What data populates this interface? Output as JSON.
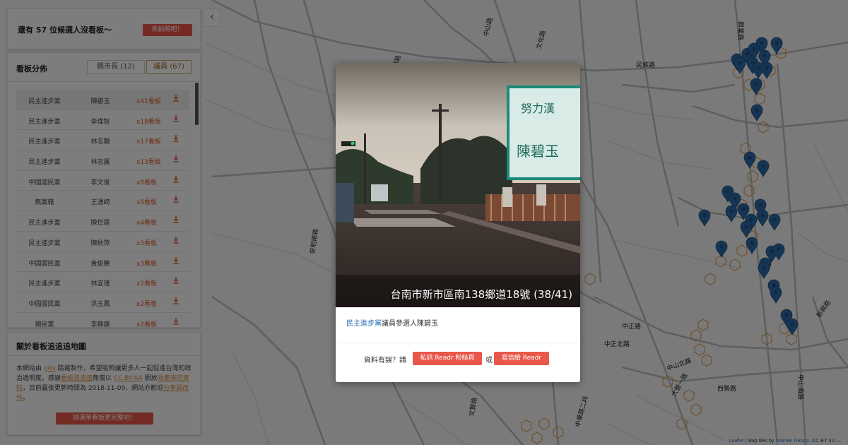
{
  "sidebar": {
    "remaining_text": "還有 57 位候選人沒看板～",
    "remaining_button": "來拍照吧！",
    "collapse_icon": "‹",
    "distribution": {
      "heading": "看板分佈",
      "tab_mayor": "縣市長 (12)",
      "tab_council": "議員 (67)",
      "rows": [
        {
          "party": "民主進步黨",
          "name": "陳碧玉",
          "count": "x41看板"
        },
        {
          "party": "民主進步黨",
          "name": "李偉智",
          "count": "x18看板"
        },
        {
          "party": "民主進步黨",
          "name": "林志聰",
          "count": "x17看板"
        },
        {
          "party": "民主進步黨",
          "name": "林志展",
          "count": "x13看板"
        },
        {
          "party": "中國國民黨",
          "name": "李文俊",
          "count": "x8看板"
        },
        {
          "party": "無黨籍",
          "name": "王湧崎",
          "count": "x5看板"
        },
        {
          "party": "民主進步黨",
          "name": "陳世霖",
          "count": "x4看板"
        },
        {
          "party": "民主進步黨",
          "name": "陳秋萍",
          "count": "x3看板"
        },
        {
          "party": "中國國民黨",
          "name": "黃俊勝",
          "count": "x3看板"
        },
        {
          "party": "民主進步黨",
          "name": "林宜瑾",
          "count": "x2看板"
        },
        {
          "party": "中國國民黨",
          "name": "洪玉鳳",
          "count": "x2看板"
        },
        {
          "party": "親民黨",
          "name": "李錦康",
          "count": "x2看板"
        }
      ]
    },
    "about": {
      "heading": "關於看板追追追地圖",
      "text_1": "本網站由 ",
      "link_g0v": "g0v",
      "text_2": " 踏遍製作，希望能夠讓更多人一起促進台灣的政治透明度。感謝",
      "link_tracker": "看板追追追",
      "text_3": "無償以 ",
      "link_license": "CC-BY-SA",
      "text_4": " 開放",
      "link_data": "收集來的資料",
      "text_5": "，目前最後更新時間為 2018-11-09，網站亦歡迎",
      "link_share": "分享與改作",
      "text_6": "。",
      "button": "請選單看板更完整吧！"
    }
  },
  "modal": {
    "caption": "台南市新市區南138鄉道18號 (38/41)",
    "party_link": "民主進步黨",
    "desc_rest": "議員參選人陳碧玉",
    "question": "資料有誤？請",
    "button_fb": "私訊 Readr 粉絲頁",
    "or": "或",
    "button_mail": "寫信給 Readr",
    "billboard_lines": [
      "努力漢",
      "陳碧玉"
    ]
  },
  "map": {
    "road_labels": [
      "中山路",
      "文化路",
      "中華路",
      "興業路",
      "民族路",
      "中正北路",
      "中山北路",
      "安明南路",
      "中正路",
      "西勢路",
      "大營一路",
      "文賢路",
      "中華路二段",
      "中山南路",
      "新興路"
    ],
    "attribution_leaflet": "Leaflet",
    "attribution_text": " | Map tiles by ",
    "attribution_stamen": "Stamen Design",
    "attribution_cc": ", CC BY 3.0 —"
  },
  "colors": {
    "accent_red": "#e8574a",
    "count_orange": "#e05a2a",
    "marker_blue": "#2d6aa6",
    "hex_orange": "#e3a35a",
    "link_blue": "#2a6fb5"
  }
}
